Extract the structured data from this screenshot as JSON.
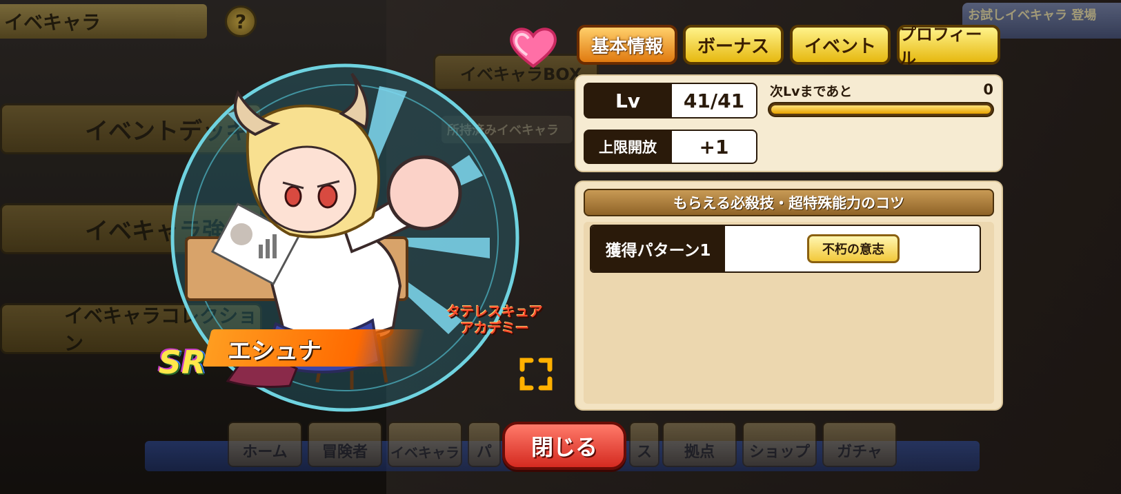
{
  "header": {
    "title": "イベキャラ",
    "help_label": "?",
    "trial_banner": "お試しイベキャラ 登場中！"
  },
  "background_menu": {
    "items": [
      "イベントデッキ",
      "イベキャラ強化",
      "イベキャラコレクション"
    ],
    "box_tab": "イベキャラBOX",
    "owned_label": "所持済みイベキャラ"
  },
  "character": {
    "rarity": "SR",
    "name": "エシュナ",
    "school_logo": "タテレスキュア アカデミー"
  },
  "tabs": [
    {
      "label": "基本情報",
      "active": true
    },
    {
      "label": "ボーナス",
      "active": false
    },
    {
      "label": "イベント",
      "active": false
    },
    {
      "label": "プロフィール",
      "active": false
    }
  ],
  "info": {
    "lv_label": "Lv",
    "lv_value": "41/41",
    "next_lv_label": "次Lvまであと",
    "next_lv_value": "0",
    "exp_progress": 1.0,
    "limit_label": "上限開放",
    "limit_value": "+1"
  },
  "kotsu": {
    "header": "もらえる必殺技・超特殊能力のコツ",
    "pattern_label": "獲得パターン1",
    "skill": "不朽の意志"
  },
  "bottom_nav": {
    "items": [
      "ホーム",
      "冒険者",
      "イベキャラ",
      "パ",
      "ス",
      "拠点",
      "ショップ",
      "ガチャ"
    ],
    "close_label": "閉じる"
  },
  "colors": {
    "tab_active": "#e07a10",
    "tab_inactive": "#e6b810",
    "panel_bg": "#f6ebd2",
    "close_button": "#d42a20",
    "exp_bar": "#e8a300"
  }
}
